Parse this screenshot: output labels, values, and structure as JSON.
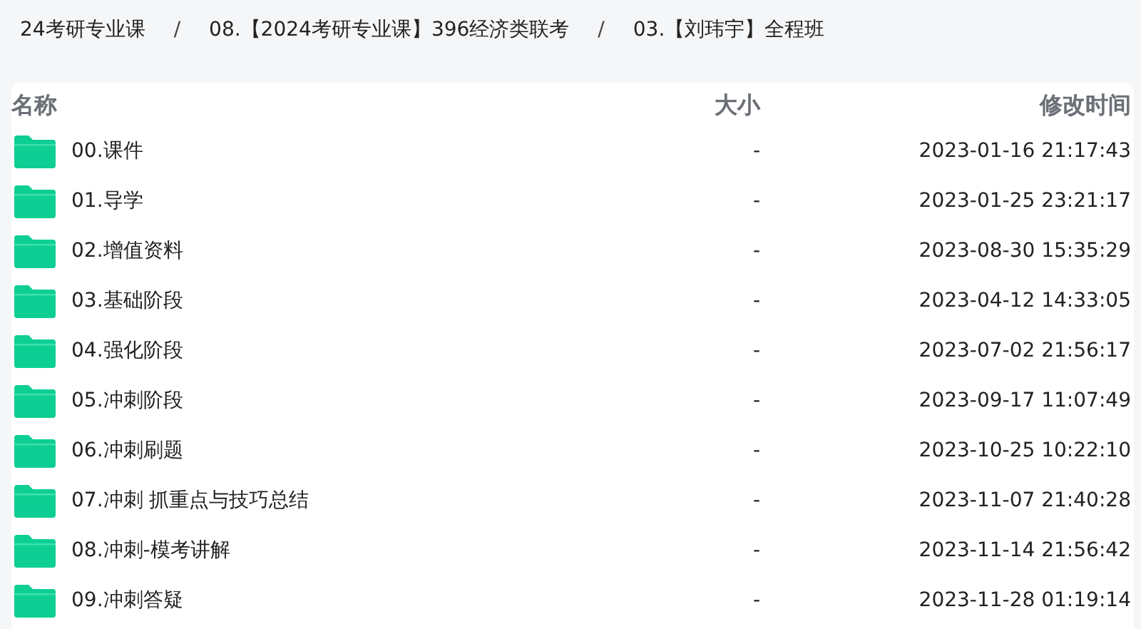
{
  "breadcrumb": [
    "24考研专业课",
    "08.【2024考研专业课】396经济类联考",
    "03.【刘玮宇】全程班"
  ],
  "breadcrumb_separator": "/",
  "table": {
    "columns": [
      "名称",
      "大小",
      "修改时间"
    ],
    "rows": [
      {
        "name": "00.课件",
        "size": "-",
        "modified": "2023-01-16 21:17:43"
      },
      {
        "name": "01.导学",
        "size": "-",
        "modified": "2023-01-25 23:21:17"
      },
      {
        "name": "02.增值资料",
        "size": "-",
        "modified": "2023-08-30 15:35:29"
      },
      {
        "name": "03.基础阶段",
        "size": "-",
        "modified": "2023-04-12 14:33:05"
      },
      {
        "name": "04.强化阶段",
        "size": "-",
        "modified": "2023-07-02 21:56:17"
      },
      {
        "name": "05.冲刺阶段",
        "size": "-",
        "modified": "2023-09-17 11:07:49"
      },
      {
        "name": "06.冲刺刷题",
        "size": "-",
        "modified": "2023-10-25 10:22:10"
      },
      {
        "name": "07.冲刺 抓重点与技巧总结",
        "size": "-",
        "modified": "2023-11-07 21:40:28"
      },
      {
        "name": "08.冲刺-模考讲解",
        "size": "-",
        "modified": "2023-11-14 21:56:42"
      },
      {
        "name": "09.冲刺答疑",
        "size": "-",
        "modified": "2023-11-28 01:19:14"
      }
    ]
  }
}
